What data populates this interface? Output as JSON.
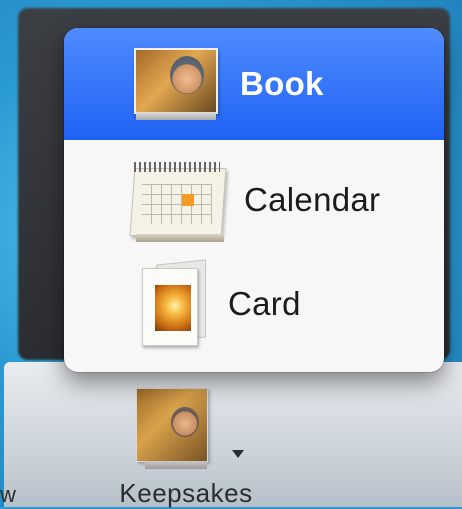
{
  "menu": {
    "items": [
      {
        "label": "Book",
        "icon": "photo-book-icon",
        "selected": true
      },
      {
        "label": "Calendar",
        "icon": "calendar-icon",
        "selected": false
      },
      {
        "label": "Card",
        "icon": "greeting-card-icon",
        "selected": false
      }
    ]
  },
  "toolbar": {
    "partial_label": "w",
    "keepsakes_label": "Keepsakes",
    "keepsakes_icon": "photo-book-icon"
  },
  "colors": {
    "selection": "#1f62f3",
    "menu_background": "#f7f7f7",
    "backdrop": "#2f9bd0"
  }
}
